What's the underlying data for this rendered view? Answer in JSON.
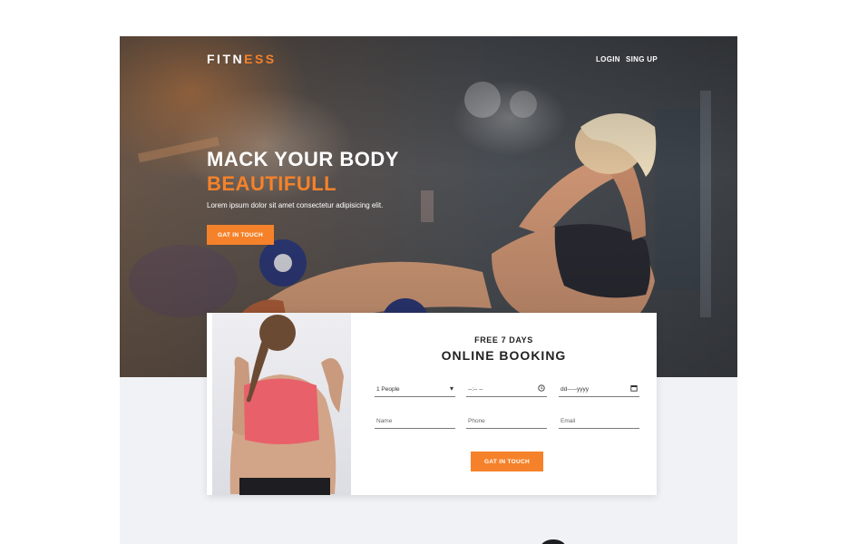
{
  "brand": {
    "name_part1": "FITN",
    "name_part2": "ESS"
  },
  "nav": {
    "login": "LOGIN",
    "signup": "SING UP"
  },
  "hero": {
    "headline_line1": "MACK YOUR BODY",
    "headline_line2": "BEAUTIFULL",
    "lead": "Lorem ipsum dolor sit amet consectetur adipisicing elit.",
    "cta": "GAT IN TOUCH"
  },
  "booking": {
    "subtitle": "FREE 7 DAYS",
    "title": "ONLINE BOOKING",
    "people_value": "1 People",
    "time_value": "--:-- --",
    "date_value": "dd-----yyyy",
    "name_placeholder": "Name",
    "phone_placeholder": "Phone",
    "email_placeholder": "Email",
    "submit": "GAT IN TOUCH"
  },
  "colors": {
    "accent": "#f5822a",
    "background": "#f0f2f5"
  },
  "icons": {
    "people_select": "chevron-down-icon",
    "time": "clock-icon",
    "date": "calendar-icon"
  }
}
